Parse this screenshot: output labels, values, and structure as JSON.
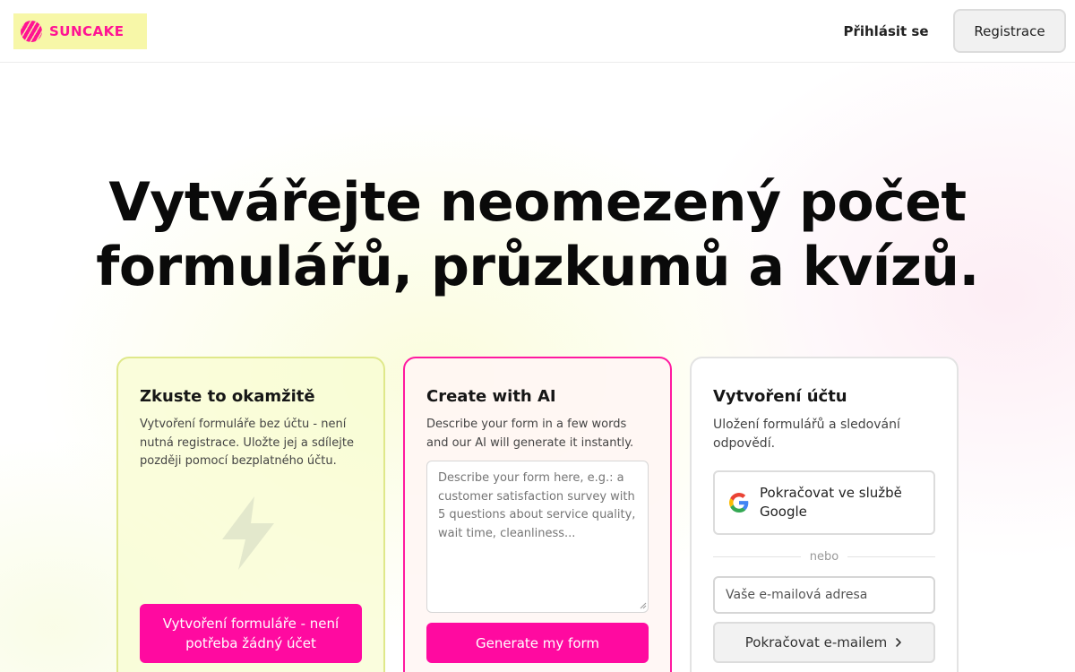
{
  "header": {
    "logo_text": "SUNCAKE",
    "login_label": "Přihlásit se",
    "register_label": "Registrace"
  },
  "hero": {
    "title_line1": "Vytvářejte neomezený počet",
    "title_line2": "formulářů, průzkumů a kvízů."
  },
  "cards": {
    "quick": {
      "title": "Zkuste to okamžitě",
      "description": "Vytvoření formuláře bez účtu - není nutná registrace. Uložte jej a sdílejte později pomocí bezplatného účtu.",
      "button_label": "Vytvoření formuláře - není potřeba žádný účet",
      "icon": "lightning-bolt-icon"
    },
    "ai": {
      "title": "Create with AI",
      "description": "Describe your form in a few words and our AI will generate it instantly.",
      "textarea_placeholder": "Describe your form here, e.g.: a customer satisfaction survey with 5 questions about service quality, wait time, cleanliness...",
      "button_label": "Generate my form"
    },
    "account": {
      "title": "Vytvoření účtu",
      "description": "Uložení formulářů a sledování odpovědí.",
      "google_label": "Pokračovat ve službě Google",
      "divider_text": "nebo",
      "email_placeholder": "Vaše e-mailová adresa",
      "email_button_label": "Pokračovat e-mailem"
    }
  },
  "colors": {
    "brand_pink": "#ff0aa0",
    "logo_bg": "#f7f7a8",
    "quick_card_border": "#dfe88a"
  }
}
